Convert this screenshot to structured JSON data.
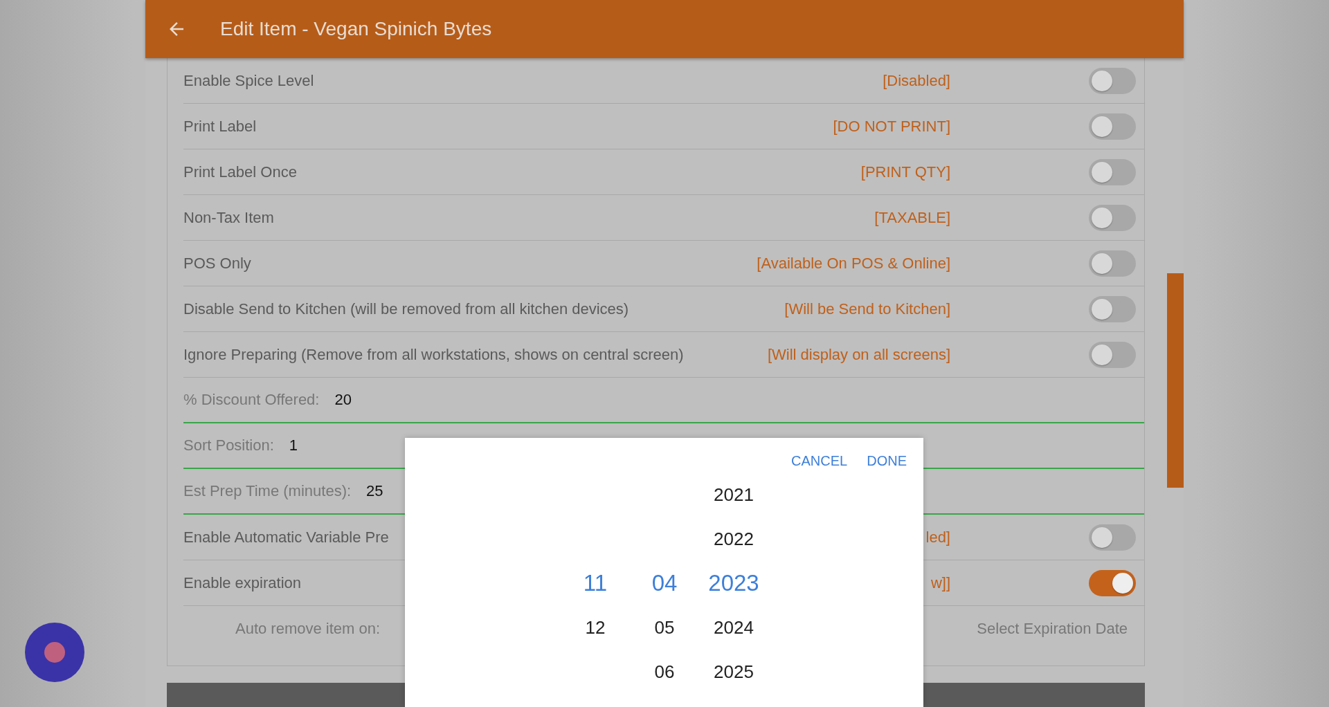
{
  "header": {
    "title": "Edit Item - Vegan Spinich Bytes"
  },
  "settings": [
    {
      "kind": "toggle",
      "label": "Enable Spice Level",
      "status": "[Disabled]",
      "on": false
    },
    {
      "kind": "toggle",
      "label": "Print Label",
      "status": "[DO NOT PRINT]",
      "on": false
    },
    {
      "kind": "toggle",
      "label": "Print Label Once",
      "status": "[PRINT QTY]",
      "on": false
    },
    {
      "kind": "toggle",
      "label": "Non-Tax Item",
      "status": "[TAXABLE]",
      "on": false
    },
    {
      "kind": "toggle",
      "label": "POS Only",
      "status": "[Available On POS & Online]",
      "on": false
    },
    {
      "kind": "toggle",
      "label": "Disable Send to Kitchen (will be removed from all kitchen devices)",
      "status": "[Will be Send to Kitchen]",
      "on": false
    },
    {
      "kind": "toggle",
      "label": "Ignore Preparing (Remove from all workstations, shows on central screen)",
      "status": "[Will display on all screens]",
      "on": false
    },
    {
      "kind": "field",
      "label": "% Discount Offered:",
      "value": "20"
    },
    {
      "kind": "field",
      "label": "Sort Position:",
      "value": "1"
    },
    {
      "kind": "field",
      "label": "Est Prep Time (minutes):",
      "value": "25"
    },
    {
      "kind": "toggle",
      "label": "Enable Automatic Variable Pre",
      "status": "led]",
      "on": false
    },
    {
      "kind": "toggle",
      "label": "Enable expiration",
      "status": "w]]",
      "on": true
    },
    {
      "kind": "date",
      "label": "Auto remove item on:",
      "placeholder": "Select Expiration Date"
    }
  ],
  "date_picker": {
    "buttons": [
      "CANCEL",
      "DONE"
    ],
    "columns": [
      {
        "items": [
          {
            "text": "11",
            "selected": true
          },
          {
            "text": "12",
            "selected": false
          }
        ]
      },
      {
        "items": [
          {
            "text": "04",
            "selected": true
          },
          {
            "text": "05",
            "selected": false
          },
          {
            "text": "06",
            "selected": false
          }
        ]
      },
      {
        "items": [
          {
            "text": "2021",
            "selected": false
          },
          {
            "text": "2022",
            "selected": false
          },
          {
            "text": "2023",
            "selected": true
          },
          {
            "text": "2024",
            "selected": false
          },
          {
            "text": "2025",
            "selected": false
          }
        ]
      }
    ]
  }
}
